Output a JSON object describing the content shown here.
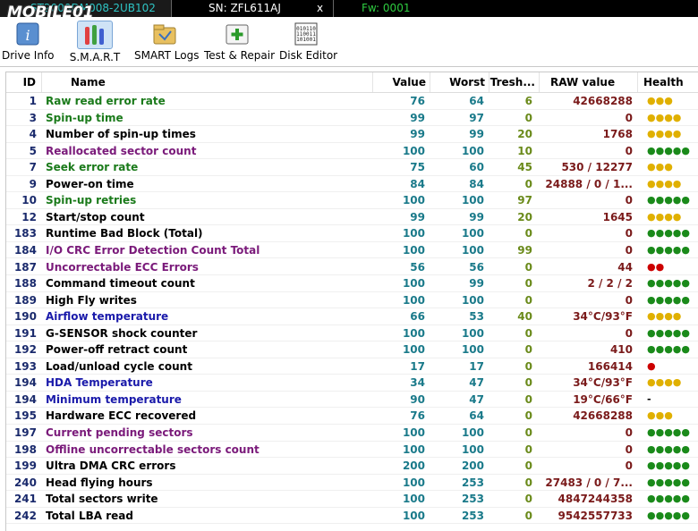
{
  "topbar": {
    "model": "ST2000DM008-2UB102",
    "serial": "SN: ZFL611AJ",
    "close": "x",
    "firmware": "Fw: 0001",
    "logo": "MOBILE01"
  },
  "toolbar": [
    {
      "label": "Drive Info",
      "icon": "info-icon"
    },
    {
      "label": "S.M.A.R.T",
      "icon": "smart-tubes-icon"
    },
    {
      "label": "SMART Logs",
      "icon": "folder-logs-icon"
    },
    {
      "label": "Test & Repair",
      "icon": "first-aid-icon"
    },
    {
      "label": "Disk Editor",
      "icon": "binary-editor-icon"
    }
  ],
  "columns": {
    "id": "ID",
    "name": "Name",
    "value": "Value",
    "worst": "Worst",
    "tresh": "Tresh...",
    "raw": "RAW value",
    "health": "Health"
  },
  "colors": {
    "green": "#1a7a1a",
    "purple": "#7a1a7a",
    "blue": "#1a1aaa",
    "black": "#000000",
    "dot_yellow": "#e0b000",
    "dot_green": "#1a8a1a",
    "dot_red": "#cc0000"
  },
  "rows": [
    {
      "id": "1",
      "name": "Raw read error rate",
      "value": "76",
      "worst": "64",
      "tresh": "6",
      "raw": "42668288",
      "health": "●●●",
      "name_color": "green",
      "health_color": "dot_yellow"
    },
    {
      "id": "3",
      "name": "Spin-up time",
      "value": "99",
      "worst": "97",
      "tresh": "0",
      "raw": "0",
      "health": "●●●●",
      "name_color": "green",
      "health_color": "dot_yellow"
    },
    {
      "id": "4",
      "name": "Number of spin-up times",
      "value": "99",
      "worst": "99",
      "tresh": "20",
      "raw": "1768",
      "health": "●●●●",
      "name_color": "black",
      "health_color": "dot_yellow"
    },
    {
      "id": "5",
      "name": "Reallocated sector count",
      "value": "100",
      "worst": "100",
      "tresh": "10",
      "raw": "0",
      "health": "●●●●●",
      "name_color": "purple",
      "health_color": "dot_green"
    },
    {
      "id": "7",
      "name": "Seek error rate",
      "value": "75",
      "worst": "60",
      "tresh": "45",
      "raw": "530 / 12277",
      "health": "●●●",
      "name_color": "green",
      "health_color": "dot_yellow"
    },
    {
      "id": "9",
      "name": "Power-on time",
      "value": "84",
      "worst": "84",
      "tresh": "0",
      "raw": "24888 / 0 / 1...",
      "health": "●●●●",
      "name_color": "black",
      "health_color": "dot_yellow"
    },
    {
      "id": "10",
      "name": "Spin-up retries",
      "value": "100",
      "worst": "100",
      "tresh": "97",
      "raw": "0",
      "health": "●●●●●",
      "name_color": "green",
      "health_color": "dot_green"
    },
    {
      "id": "12",
      "name": "Start/stop count",
      "value": "99",
      "worst": "99",
      "tresh": "20",
      "raw": "1645",
      "health": "●●●●",
      "name_color": "black",
      "health_color": "dot_yellow"
    },
    {
      "id": "183",
      "name": "Runtime Bad Block (Total)",
      "value": "100",
      "worst": "100",
      "tresh": "0",
      "raw": "0",
      "health": "●●●●●",
      "name_color": "black",
      "health_color": "dot_green"
    },
    {
      "id": "184",
      "name": "I/O CRC Error Detection Count Total",
      "value": "100",
      "worst": "100",
      "tresh": "99",
      "raw": "0",
      "health": "●●●●●",
      "name_color": "purple",
      "health_color": "dot_green"
    },
    {
      "id": "187",
      "name": "Uncorrectable ECC Errors",
      "value": "56",
      "worst": "56",
      "tresh": "0",
      "raw": "44",
      "health": "●●",
      "name_color": "purple",
      "health_color": "dot_red"
    },
    {
      "id": "188",
      "name": "Command timeout count",
      "value": "100",
      "worst": "99",
      "tresh": "0",
      "raw": "2 / 2 / 2",
      "health": "●●●●●",
      "name_color": "black",
      "health_color": "dot_green"
    },
    {
      "id": "189",
      "name": "High Fly writes",
      "value": "100",
      "worst": "100",
      "tresh": "0",
      "raw": "0",
      "health": "●●●●●",
      "name_color": "black",
      "health_color": "dot_green"
    },
    {
      "id": "190",
      "name": "Airflow temperature",
      "value": "66",
      "worst": "53",
      "tresh": "40",
      "raw": "34°C/93°F",
      "health": "●●●●",
      "name_color": "blue",
      "health_color": "dot_yellow"
    },
    {
      "id": "191",
      "name": "G-SENSOR shock counter",
      "value": "100",
      "worst": "100",
      "tresh": "0",
      "raw": "0",
      "health": "●●●●●",
      "name_color": "black",
      "health_color": "dot_green"
    },
    {
      "id": "192",
      "name": "Power-off retract count",
      "value": "100",
      "worst": "100",
      "tresh": "0",
      "raw": "410",
      "health": "●●●●●",
      "name_color": "black",
      "health_color": "dot_green"
    },
    {
      "id": "193",
      "name": "Load/unload cycle count",
      "value": "17",
      "worst": "17",
      "tresh": "0",
      "raw": "166414",
      "health": "●",
      "name_color": "black",
      "health_color": "dot_red"
    },
    {
      "id": "194",
      "name": "HDA Temperature",
      "value": "34",
      "worst": "47",
      "tresh": "0",
      "raw": "34°C/93°F",
      "health": "●●●●",
      "name_color": "blue",
      "health_color": "dot_yellow"
    },
    {
      "id": "194",
      "name": "Minimum temperature",
      "value": "90",
      "worst": "47",
      "tresh": "0",
      "raw": "19°C/66°F",
      "health": "-",
      "name_color": "blue",
      "health_color": "black"
    },
    {
      "id": "195",
      "name": "Hardware ECC recovered",
      "value": "76",
      "worst": "64",
      "tresh": "0",
      "raw": "42668288",
      "health": "●●●",
      "name_color": "black",
      "health_color": "dot_yellow"
    },
    {
      "id": "197",
      "name": "Current pending sectors",
      "value": "100",
      "worst": "100",
      "tresh": "0",
      "raw": "0",
      "health": "●●●●●",
      "name_color": "purple",
      "health_color": "dot_green"
    },
    {
      "id": "198",
      "name": "Offline uncorrectable sectors count",
      "value": "100",
      "worst": "100",
      "tresh": "0",
      "raw": "0",
      "health": "●●●●●",
      "name_color": "purple",
      "health_color": "dot_green"
    },
    {
      "id": "199",
      "name": "Ultra DMA CRC errors",
      "value": "200",
      "worst": "200",
      "tresh": "0",
      "raw": "0",
      "health": "●●●●●",
      "name_color": "black",
      "health_color": "dot_green"
    },
    {
      "id": "240",
      "name": "Head flying hours",
      "value": "100",
      "worst": "253",
      "tresh": "0",
      "raw": "27483 / 0 / 7...",
      "health": "●●●●●",
      "name_color": "black",
      "health_color": "dot_green"
    },
    {
      "id": "241",
      "name": "Total sectors write",
      "value": "100",
      "worst": "253",
      "tresh": "0",
      "raw": "4847244358",
      "health": "●●●●●",
      "name_color": "black",
      "health_color": "dot_green"
    },
    {
      "id": "242",
      "name": "Total LBA read",
      "value": "100",
      "worst": "253",
      "tresh": "0",
      "raw": "9542557733",
      "health": "●●●●●",
      "name_color": "black",
      "health_color": "dot_green"
    }
  ]
}
